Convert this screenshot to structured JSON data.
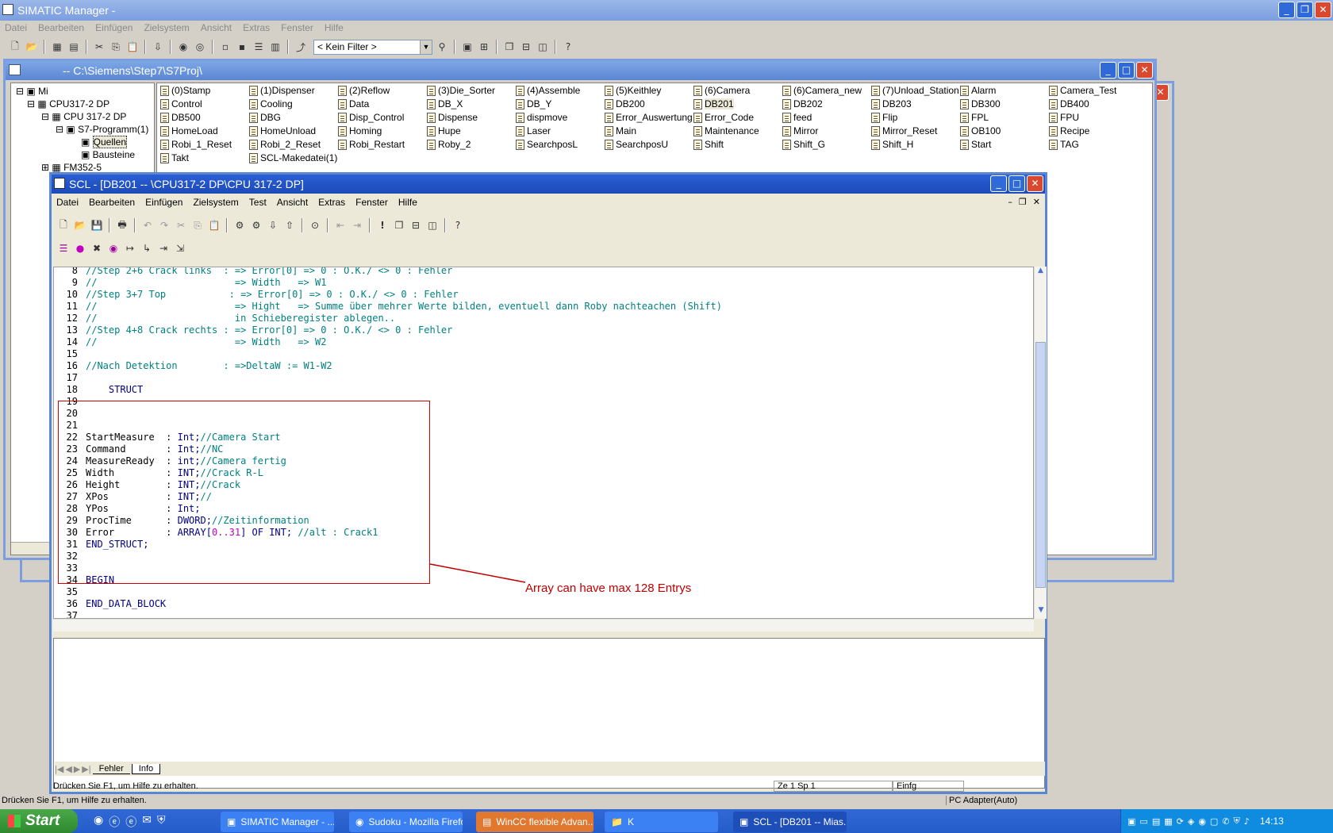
{
  "main_window": {
    "title": "SIMATIC Manager -",
    "menu": [
      "Datei",
      "Bearbeiten",
      "Einfügen",
      "Zielsystem",
      "Ansicht",
      "Extras",
      "Fenster",
      "Hilfe"
    ],
    "filter": "< Kein Filter >",
    "status": "Drücken Sie F1, um Hilfe zu erhalten.",
    "adapter": "PC Adapter(Auto)"
  },
  "project_window": {
    "title": "-- C:\\Siemens\\Step7\\S7Proj\\",
    "tree": [
      "Mi",
      "CPU317-2 DP",
      "CPU 317-2 DP",
      "S7-Programm(1)",
      "Quellen",
      "Bausteine",
      "FM352-5"
    ],
    "blocks": [
      [
        "(0)Stamp",
        "Control",
        "DB500",
        "HomeLoad",
        "Robi_1_Reset",
        "Takt"
      ],
      [
        "(1)Dispenser",
        "Cooling",
        "DBG",
        "HomeUnload",
        "Robi_2_Reset",
        "SCL-Makedatei(1)"
      ],
      [
        "(2)Reflow",
        "Data",
        "Disp_Control",
        "Homing",
        "Robi_Restart"
      ],
      [
        "(3)Die_Sorter",
        "DB_X",
        "Dispense",
        "Hupe",
        "Roby_2"
      ],
      [
        "(4)Assemble",
        "DB_Y",
        "dispmove",
        "Laser",
        "SearchposL"
      ],
      [
        "(5)Keithley",
        "DB200",
        "Error_Auswertung",
        "Main",
        "SearchposU"
      ],
      [
        "(6)Camera",
        "DB201",
        "Error_Code",
        "Maintenance",
        "Shift"
      ],
      [
        "(6)Camera_new",
        "DB202",
        "feed",
        "Mirror",
        "Shift_G"
      ],
      [
        "(7)Unload_Station",
        "DB203",
        "Flip",
        "Mirror_Reset",
        "Shift_H"
      ],
      [
        "Alarm",
        "DB300",
        "FPL",
        "OB100",
        "Start"
      ],
      [
        "Camera_Test",
        "DB400",
        "FPU",
        "Recipe",
        "TAG"
      ]
    ]
  },
  "scl_window": {
    "title": "SCL  - [DB201 --          \\CPU317-2 DP\\CPU 317-2 DP]",
    "menu": [
      "Datei",
      "Bearbeiten",
      "Einfügen",
      "Zielsystem",
      "Test",
      "Ansicht",
      "Extras",
      "Fenster",
      "Hilfe"
    ],
    "tabs": [
      "Fehler",
      "Info"
    ],
    "status": "Drücken Sie F1, um Hilfe zu erhalten.",
    "position": "Ze 1 Sp 1",
    "mode": "Einfg"
  },
  "code_lines": [
    {
      "n": "8",
      "t": "//Step 2+6 Crack links  : => Error[0] => 0 : O.K./ <> 0 : Fehler"
    },
    {
      "n": "9",
      "t": "//                        => Width   => W1"
    },
    {
      "n": "10",
      "t": "//Step 3+7 Top           : => Error[0] => 0 : O.K./ <> 0 : Fehler"
    },
    {
      "n": "11",
      "t": "//                        => Hight   => Summe über mehrer Werte bilden, eventuell dann Roby nachteachen (Shift)"
    },
    {
      "n": "12",
      "t": "//                        in Schieberegister ablegen.."
    },
    {
      "n": "13",
      "t": "//Step 4+8 Crack rechts : => Error[0] => 0 : O.K./ <> 0 : Fehler"
    },
    {
      "n": "14",
      "t": "//                        => Width   => W2"
    },
    {
      "n": "15",
      "t": ""
    },
    {
      "n": "16",
      "t": "//Nach Detektion        : =>DeltaW := W1-W2"
    },
    {
      "n": "17",
      "t": ""
    },
    {
      "n": "18",
      "t": "    STRUCT"
    },
    {
      "n": "19",
      "t": ""
    },
    {
      "n": "20",
      "t": ""
    },
    {
      "n": "21",
      "t": ""
    },
    {
      "n": "22",
      "a": "StartMeasure  : ",
      "b": "Int;",
      "c": "//Camera Start"
    },
    {
      "n": "23",
      "a": "Command       : ",
      "b": "Int;",
      "c": "//NC"
    },
    {
      "n": "24",
      "a": "MeasureReady  : ",
      "b": "int;",
      "c": "//Camera fertig"
    },
    {
      "n": "25",
      "a": "Width         : ",
      "b": "INT;",
      "c": "//Crack R-L"
    },
    {
      "n": "26",
      "a": "Height        : ",
      "b": "INT;",
      "c": "//Crack"
    },
    {
      "n": "27",
      "a": "XPos          : ",
      "b": "INT;",
      "c": "//"
    },
    {
      "n": "28",
      "a": "YPos          : ",
      "b": "Int;",
      "c": ""
    },
    {
      "n": "29",
      "a": "ProcTime      : ",
      "b": "DWORD;",
      "c": "//Zeitinformation"
    },
    {
      "n": "30",
      "a": "Error         : ",
      "b": "ARRAY[",
      "d": "0..31",
      "e": "] OF INT; ",
      "c": "//alt : Crack1"
    },
    {
      "n": "31",
      "t": "END_STRUCT;"
    },
    {
      "n": "32",
      "t": ""
    },
    {
      "n": "33",
      "t": ""
    },
    {
      "n": "34",
      "t": "BEGIN"
    },
    {
      "n": "35",
      "t": ""
    },
    {
      "n": "36",
      "t": "END_DATA_BLOCK"
    },
    {
      "n": "37",
      "t": ""
    }
  ],
  "annotation": "Array can have max 128 Entrys",
  "taskbar": {
    "start": "Start",
    "items": [
      "SIMATIC Manager - ...",
      "Sudoku - Mozilla Firefox",
      "WinCC flexible Advan...",
      "K",
      "SCL  - [DB201 -- Mias..."
    ],
    "clock": "14:13"
  },
  "colors": {
    "title_bar": "#5a86d4",
    "comment": "#008080",
    "keyword": "#000080",
    "annotation": "#c00000"
  }
}
